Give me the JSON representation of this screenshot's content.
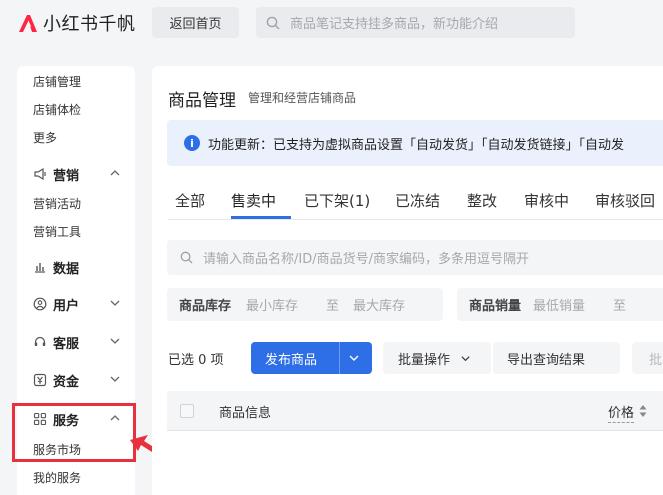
{
  "header": {
    "logo_text": "小红书千帆",
    "home_button": "返回首页",
    "search_placeholder": "商品笔记支持挂多商品，新功能介绍"
  },
  "sidebar": {
    "top_items": [
      "店铺管理",
      "店铺体检",
      "更多"
    ],
    "marketing": {
      "label": "营销",
      "items": [
        "营销活动",
        "营销工具"
      ]
    },
    "data": {
      "label": "数据"
    },
    "users": {
      "label": "用户"
    },
    "service_cs": {
      "label": "客服"
    },
    "funds": {
      "label": "资金"
    },
    "services": {
      "label": "服务",
      "items": [
        "服务市场",
        "我的服务"
      ]
    }
  },
  "main": {
    "title": "商品管理",
    "subtitle": "管理和经营店铺商品",
    "notice": "功能更新：已支持为虚拟商品设置「自动发货」「自动发货链接」「自动发",
    "tabs": [
      "全部",
      "售卖中",
      "已下架(1)",
      "已冻结",
      "整改",
      "审核中",
      "审核驳回"
    ],
    "active_tab": "售卖中",
    "query_placeholder": "请输入商品名称/ID/商品货号/商家编码，多条用逗号隔开",
    "stock_filter": {
      "label": "商品库存",
      "min": "最小库存",
      "to": "至",
      "max": "最大库存"
    },
    "sales_filter": {
      "label": "商品销量",
      "min": "最低销量",
      "to": "至"
    },
    "selected_count": "已选 0 项",
    "publish_button": "发布商品",
    "batch_button": "批量操作",
    "export_button": "导出查询结果",
    "extra_button": "批",
    "table": {
      "col_info": "商品信息",
      "col_price": "价格"
    }
  },
  "colors": {
    "accent": "#2e6ee6",
    "brand": "#ff2442",
    "highlight": "#e8313d"
  }
}
